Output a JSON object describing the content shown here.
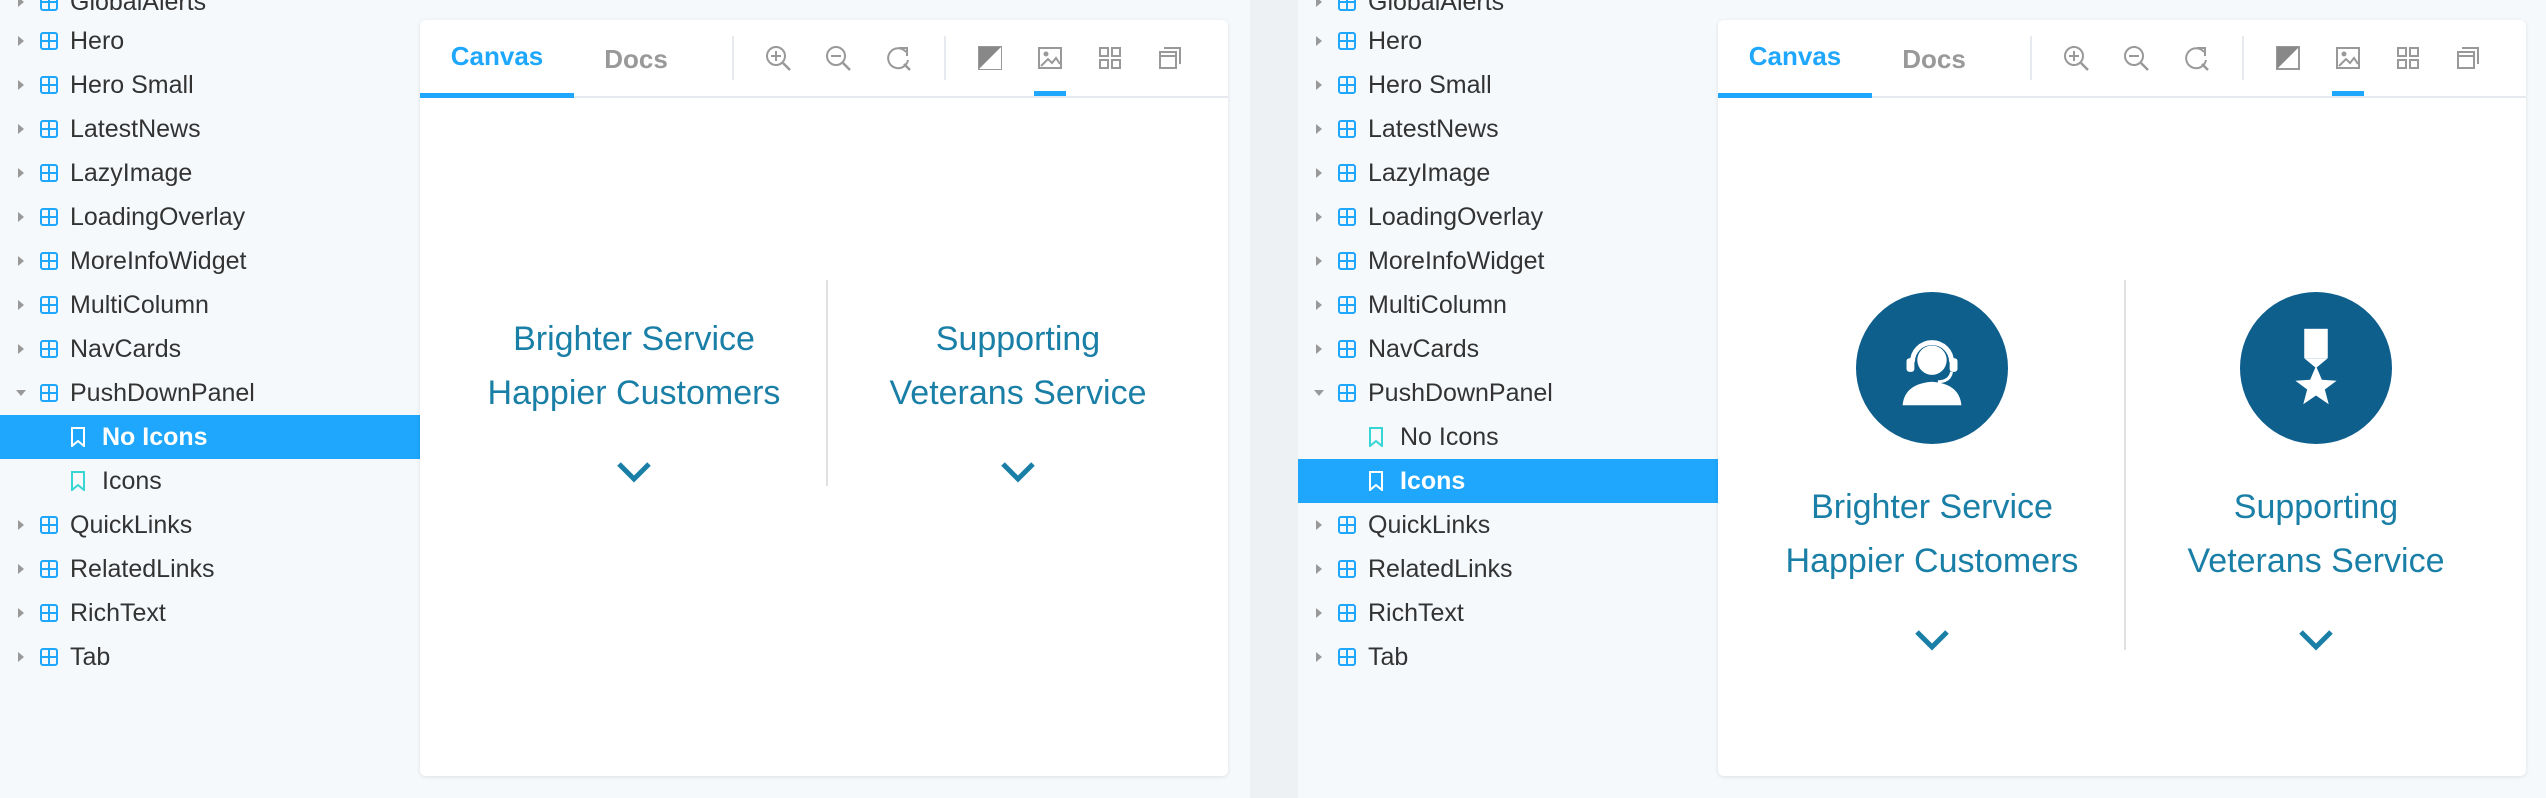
{
  "sidebar": {
    "items": [
      {
        "label": "GlobalAlerts"
      },
      {
        "label": "Hero"
      },
      {
        "label": "Hero Small"
      },
      {
        "label": "LatestNews"
      },
      {
        "label": "LazyImage"
      },
      {
        "label": "LoadingOverlay"
      },
      {
        "label": "MoreInfoWidget"
      },
      {
        "label": "MultiColumn"
      },
      {
        "label": "NavCards"
      },
      {
        "label": "PushDownPanel"
      },
      {
        "label": "No Icons"
      },
      {
        "label": "Icons"
      },
      {
        "label": "QuickLinks"
      },
      {
        "label": "RelatedLinks"
      },
      {
        "label": "RichText"
      },
      {
        "label": "Tab"
      }
    ]
  },
  "toolbar": {
    "tabs": [
      {
        "label": "Canvas"
      },
      {
        "label": "Docs"
      }
    ],
    "icons": [
      "zoom-in-icon",
      "zoom-out-icon",
      "reset-zoom-icon",
      "contrast-icon",
      "image-icon",
      "grid-icon",
      "outline-icon"
    ]
  },
  "panel": {
    "left_col": {
      "line1": "Brighter Service",
      "line2": "Happier Customers"
    },
    "right_col": {
      "line1": "Supporting",
      "line2": "Veterans Service"
    }
  },
  "colors": {
    "accent": "#1ea7fd",
    "panel_text": "#1a7fa6",
    "icon_circle": "#0e5f8c"
  },
  "views": {
    "left_selected_story": "No Icons",
    "right_selected_story": "Icons"
  }
}
